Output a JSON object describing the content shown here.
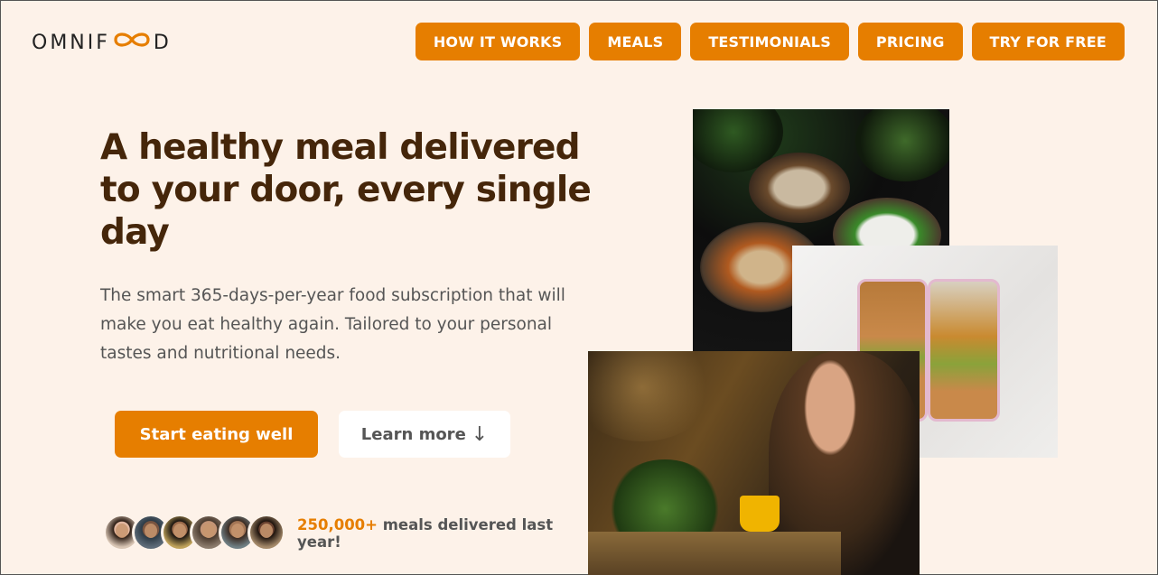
{
  "brand": {
    "logo_left": "OMNIF",
    "logo_right": "D",
    "accent": "#e67e00",
    "title_color": "#45260a",
    "background": "#fdf2e9"
  },
  "nav": {
    "items": [
      "HOW IT WORKS",
      "MEALS",
      "TESTIMONIALS",
      "PRICING",
      "TRY FOR FREE"
    ]
  },
  "hero": {
    "title": "A healthy meal delivered to your door, every single day",
    "description": "The smart 365-days-per-year food subscription that will make you eat healthy again. Tailored to your personal tastes and nutritional needs.",
    "primary_cta": "Start eating well",
    "secondary_cta": "Learn more",
    "secondary_cta_icon": "↓"
  },
  "delivered": {
    "highlight": "250,000+",
    "text": " meals delivered last year!",
    "avatars": [
      "customer-1",
      "customer-2",
      "customer-3",
      "customer-4",
      "customer-5",
      "customer-6"
    ]
  },
  "images": [
    "bowls-photo",
    "meal-boxes-photo",
    "woman-eating-photo"
  ]
}
